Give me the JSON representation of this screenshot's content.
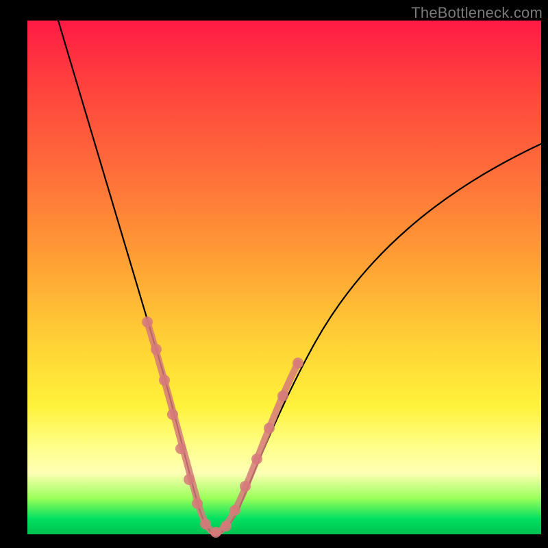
{
  "watermark": "TheBottleneck.com",
  "chart_data": {
    "type": "line",
    "title": "",
    "xlabel": "",
    "ylabel": "",
    "xlim": [
      0,
      100
    ],
    "ylim": [
      0,
      100
    ],
    "grid": false,
    "legend": false,
    "background_gradient": [
      "#ff1a45",
      "#ff9a35",
      "#fff23a",
      "#00c050"
    ],
    "series": [
      {
        "name": "bottleneck-curve",
        "x": [
          6,
          10,
          15,
          20,
          23,
          26,
          28,
          30,
          32,
          34,
          36,
          40,
          45,
          50,
          55,
          62,
          70,
          80,
          90,
          100
        ],
        "y": [
          100,
          90,
          76,
          60,
          48,
          36,
          26,
          16,
          8,
          2,
          0,
          2,
          8,
          16,
          28,
          40,
          52,
          62,
          70,
          76
        ]
      }
    ],
    "highlight_segments": [
      {
        "name": "left-branch",
        "x_range": [
          22,
          34
        ],
        "style": "thick-salmon"
      },
      {
        "name": "right-branch",
        "x_range": [
          34,
          48
        ],
        "style": "thick-salmon"
      }
    ],
    "markers": [
      {
        "x": 22,
        "y": 52
      },
      {
        "x": 24,
        "y": 44
      },
      {
        "x": 26,
        "y": 34
      },
      {
        "x": 27.5,
        "y": 26
      },
      {
        "x": 29,
        "y": 18
      },
      {
        "x": 30.5,
        "y": 11
      },
      {
        "x": 32,
        "y": 6
      },
      {
        "x": 33.5,
        "y": 2
      },
      {
        "x": 35,
        "y": 0
      },
      {
        "x": 36.5,
        "y": 0.5
      },
      {
        "x": 38,
        "y": 2
      },
      {
        "x": 40,
        "y": 5
      },
      {
        "x": 42,
        "y": 10
      },
      {
        "x": 44,
        "y": 16
      },
      {
        "x": 46,
        "y": 23
      },
      {
        "x": 48,
        "y": 30
      }
    ]
  }
}
